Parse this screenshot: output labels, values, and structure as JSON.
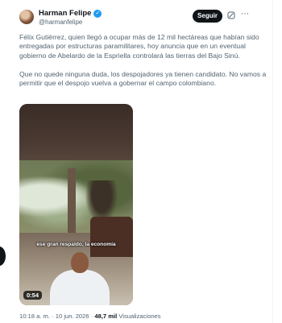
{
  "author": {
    "name": "Harman Felipe",
    "handle": "@harmanfelipe",
    "verified_badge": "✓"
  },
  "header": {
    "follow_label": "Seguir",
    "more_icon": "⋯"
  },
  "tweet": {
    "paragraphs": [
      "Félix Gutiérrez, quien llegó a ocupar más de 12 mil hectáreas que habían sido entregadas por estructuras paramilitares, hoy anuncia que en un eventual gobierno de Abelardo de la Espriella controlará las tierras del Bajo Sinú.",
      "Que no quede ninguna duda, los despojadores ya tienen candidato. No vamos a permitir que el despojo vuelva a gobernar el campo colombiano."
    ]
  },
  "video": {
    "caption": "ese gran respaldo, la economía",
    "duration": "0:54"
  },
  "meta": {
    "time": "10:18 a. m.",
    "separator": "·",
    "date": "10 jun. 2026",
    "views_count": "48,7 mil",
    "views_label": "Visualizaciones"
  },
  "colors": {
    "text": "#0f1419",
    "secondary": "#536471",
    "verified": "#1d9bf0"
  }
}
